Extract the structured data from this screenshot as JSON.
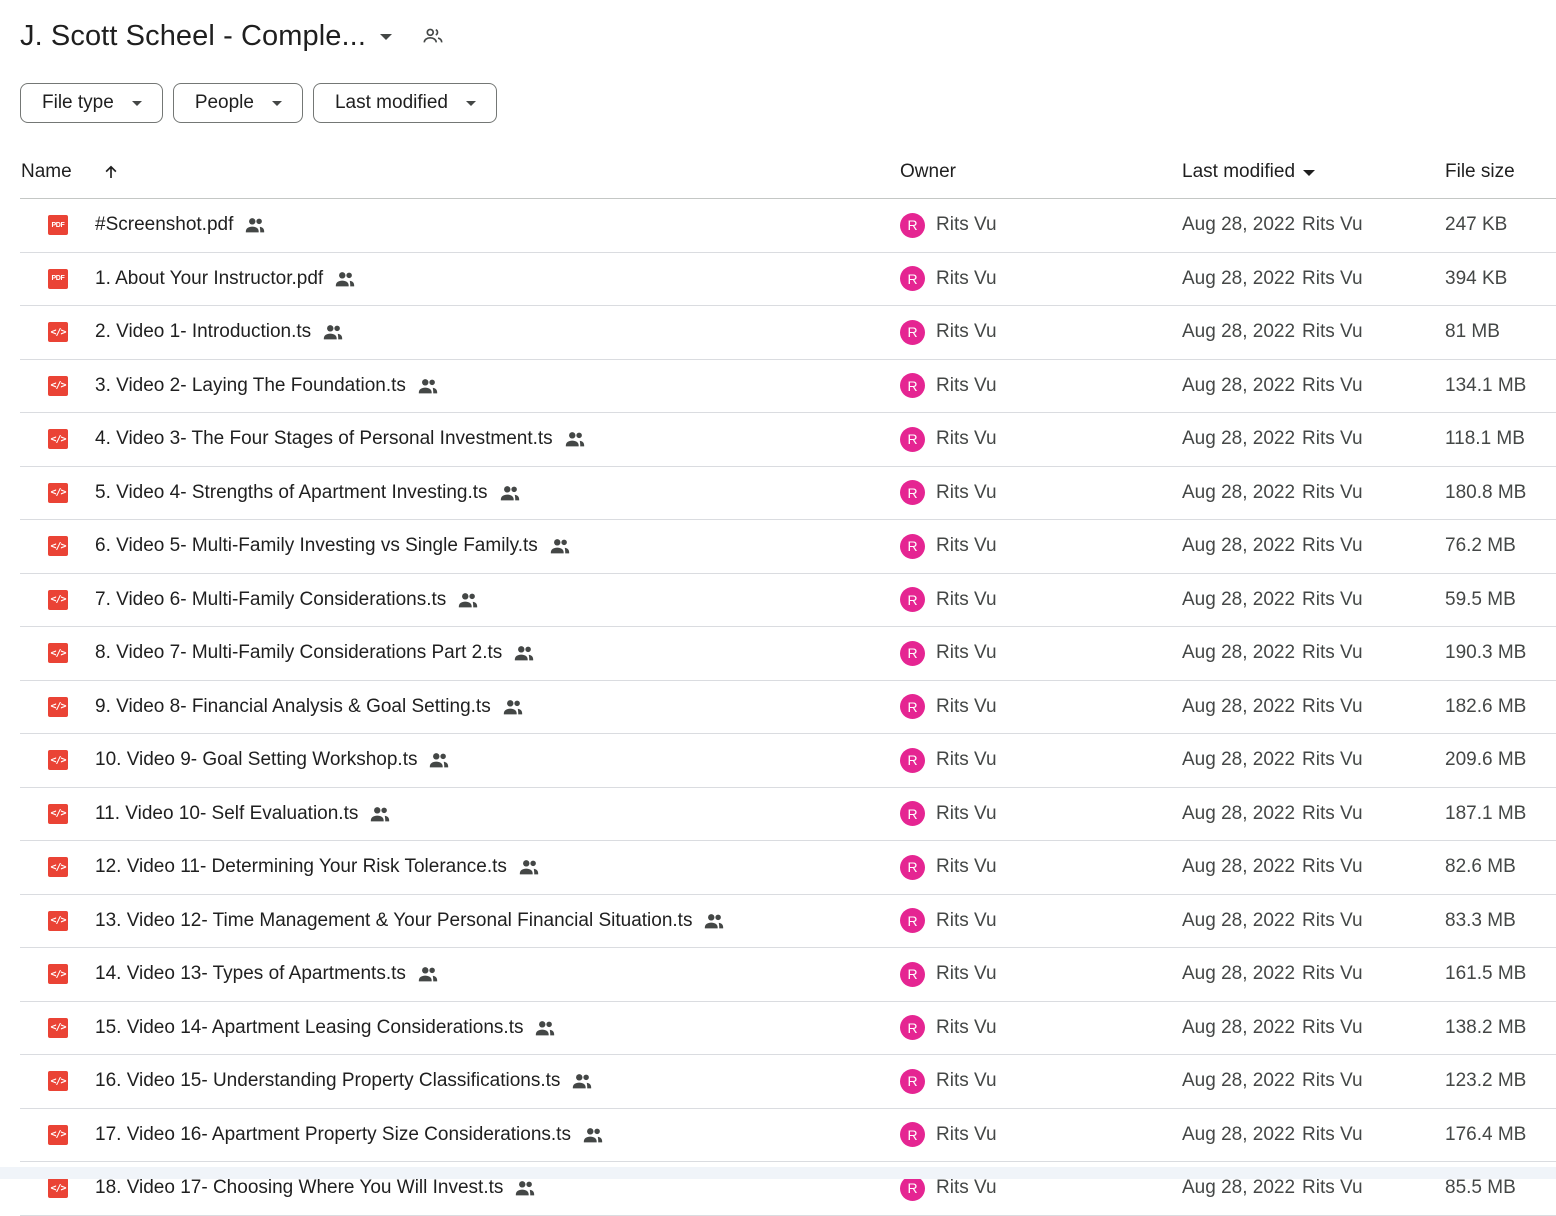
{
  "header": {
    "title": "J. Scott Scheel - Comple..."
  },
  "filters": [
    "File type",
    "People",
    "Last modified"
  ],
  "columns": {
    "name": "Name",
    "owner": "Owner",
    "last_modified": "Last modified",
    "file_size": "File size"
  },
  "colors": {
    "file_icon": "#ea4335",
    "avatar": "#e52592"
  },
  "files": [
    {
      "type": "pdf",
      "icon": "pdf-icon",
      "name": "#Screenshot.pdf",
      "owner_initial": "R",
      "owner": "Rits Vu",
      "modified": "Aug 28, 2022",
      "modified_by": "Rits Vu",
      "size": "247 KB"
    },
    {
      "type": "pdf",
      "icon": "pdf-icon",
      "name": "1. About Your Instructor.pdf",
      "owner_initial": "R",
      "owner": "Rits Vu",
      "modified": "Aug 28, 2022",
      "modified_by": "Rits Vu",
      "size": "394 KB"
    },
    {
      "type": "code",
      "icon": "code-file-icon",
      "name": "2. Video 1- Introduction.ts",
      "owner_initial": "R",
      "owner": "Rits Vu",
      "modified": "Aug 28, 2022",
      "modified_by": "Rits Vu",
      "size": "81 MB"
    },
    {
      "type": "code",
      "icon": "code-file-icon",
      "name": "3. Video 2- Laying The Foundation.ts",
      "owner_initial": "R",
      "owner": "Rits Vu",
      "modified": "Aug 28, 2022",
      "modified_by": "Rits Vu",
      "size": "134.1 MB"
    },
    {
      "type": "code",
      "icon": "code-file-icon",
      "name": "4. Video 3- The Four Stages of Personal Investment.ts",
      "owner_initial": "R",
      "owner": "Rits Vu",
      "modified": "Aug 28, 2022",
      "modified_by": "Rits Vu",
      "size": "118.1 MB"
    },
    {
      "type": "code",
      "icon": "code-file-icon",
      "name": "5. Video 4- Strengths of Apartment Investing.ts",
      "owner_initial": "R",
      "owner": "Rits Vu",
      "modified": "Aug 28, 2022",
      "modified_by": "Rits Vu",
      "size": "180.8 MB"
    },
    {
      "type": "code",
      "icon": "code-file-icon",
      "name": "6. Video 5- Multi-Family Investing vs Single Family.ts",
      "owner_initial": "R",
      "owner": "Rits Vu",
      "modified": "Aug 28, 2022",
      "modified_by": "Rits Vu",
      "size": "76.2 MB"
    },
    {
      "type": "code",
      "icon": "code-file-icon",
      "name": "7. Video 6- Multi-Family Considerations.ts",
      "owner_initial": "R",
      "owner": "Rits Vu",
      "modified": "Aug 28, 2022",
      "modified_by": "Rits Vu",
      "size": "59.5 MB"
    },
    {
      "type": "code",
      "icon": "code-file-icon",
      "name": "8. Video 7- Multi-Family Considerations Part 2.ts",
      "owner_initial": "R",
      "owner": "Rits Vu",
      "modified": "Aug 28, 2022",
      "modified_by": "Rits Vu",
      "size": "190.3 MB"
    },
    {
      "type": "code",
      "icon": "code-file-icon",
      "name": "9. Video 8- Financial Analysis & Goal Setting.ts",
      "owner_initial": "R",
      "owner": "Rits Vu",
      "modified": "Aug 28, 2022",
      "modified_by": "Rits Vu",
      "size": "182.6 MB"
    },
    {
      "type": "code",
      "icon": "code-file-icon",
      "name": "10. Video 9- Goal Setting Workshop.ts",
      "owner_initial": "R",
      "owner": "Rits Vu",
      "modified": "Aug 28, 2022",
      "modified_by": "Rits Vu",
      "size": "209.6 MB"
    },
    {
      "type": "code",
      "icon": "code-file-icon",
      "name": "11. Video 10- Self Evaluation.ts",
      "owner_initial": "R",
      "owner": "Rits Vu",
      "modified": "Aug 28, 2022",
      "modified_by": "Rits Vu",
      "size": "187.1 MB"
    },
    {
      "type": "code",
      "icon": "code-file-icon",
      "name": "12. Video 11- Determining Your Risk Tolerance.ts",
      "owner_initial": "R",
      "owner": "Rits Vu",
      "modified": "Aug 28, 2022",
      "modified_by": "Rits Vu",
      "size": "82.6 MB"
    },
    {
      "type": "code",
      "icon": "code-file-icon",
      "name": "13. Video 12- Time Management & Your Personal Financial Situation.ts",
      "owner_initial": "R",
      "owner": "Rits Vu",
      "modified": "Aug 28, 2022",
      "modified_by": "Rits Vu",
      "size": "83.3 MB"
    },
    {
      "type": "code",
      "icon": "code-file-icon",
      "name": "14. Video 13- Types of Apartments.ts",
      "owner_initial": "R",
      "owner": "Rits Vu",
      "modified": "Aug 28, 2022",
      "modified_by": "Rits Vu",
      "size": "161.5 MB"
    },
    {
      "type": "code",
      "icon": "code-file-icon",
      "name": "15. Video 14- Apartment Leasing Considerations.ts",
      "owner_initial": "R",
      "owner": "Rits Vu",
      "modified": "Aug 28, 2022",
      "modified_by": "Rits Vu",
      "size": "138.2 MB"
    },
    {
      "type": "code",
      "icon": "code-file-icon",
      "name": "16. Video 15- Understanding Property Classifications.ts",
      "owner_initial": "R",
      "owner": "Rits Vu",
      "modified": "Aug 28, 2022",
      "modified_by": "Rits Vu",
      "size": "123.2 MB"
    },
    {
      "type": "code",
      "icon": "code-file-icon",
      "name": "17. Video 16- Apartment Property Size Considerations.ts",
      "owner_initial": "R",
      "owner": "Rits Vu",
      "modified": "Aug 28, 2022",
      "modified_by": "Rits Vu",
      "size": "176.4 MB"
    },
    {
      "type": "code",
      "icon": "code-file-icon",
      "name": "18. Video 17- Choosing Where You Will Invest.ts",
      "owner_initial": "R",
      "owner": "Rits Vu",
      "modified": "Aug 28, 2022",
      "modified_by": "Rits Vu",
      "size": "85.5 MB"
    }
  ]
}
